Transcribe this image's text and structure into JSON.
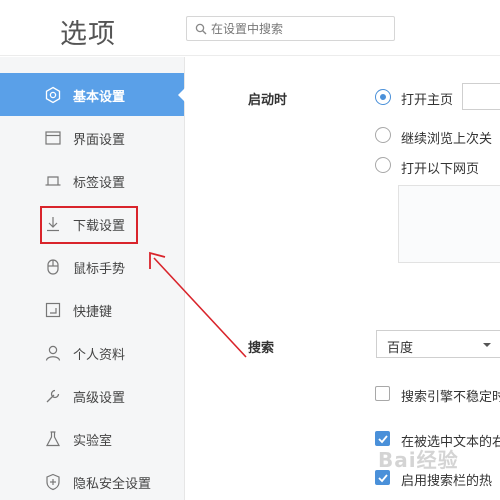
{
  "header": {
    "title": "选项",
    "search_placeholder": "在设置中搜索"
  },
  "sidebar": {
    "items": [
      {
        "label": "基本设置",
        "icon": "settings-icon"
      },
      {
        "label": "界面设置",
        "icon": "window-icon"
      },
      {
        "label": "标签设置",
        "icon": "tab-icon"
      },
      {
        "label": "下载设置",
        "icon": "download-icon"
      },
      {
        "label": "鼠标手势",
        "icon": "mouse-icon"
      },
      {
        "label": "快捷键",
        "icon": "shortcut-icon"
      },
      {
        "label": "个人资料",
        "icon": "user-icon"
      },
      {
        "label": "高级设置",
        "icon": "wrench-icon"
      },
      {
        "label": "实验室",
        "icon": "flask-icon"
      },
      {
        "label": "隐私安全设置",
        "icon": "shield-icon"
      }
    ],
    "active_index": 0
  },
  "startup": {
    "label": "启动时",
    "options": [
      "打开主页",
      "继续浏览上次关",
      "打开以下网页"
    ],
    "selected": "打开主页"
  },
  "search_section": {
    "label": "搜索",
    "engine": "百度",
    "checkboxes": [
      {
        "label": "搜索引擎不稳定时",
        "checked": false
      },
      {
        "label": "在被选中文本的右",
        "checked": true
      },
      {
        "label": "启用搜索栏的热",
        "checked": true
      }
    ]
  },
  "watermark": "Bai经验",
  "colors": {
    "accent": "#5aa0e8",
    "annotation": "#d9242b"
  }
}
